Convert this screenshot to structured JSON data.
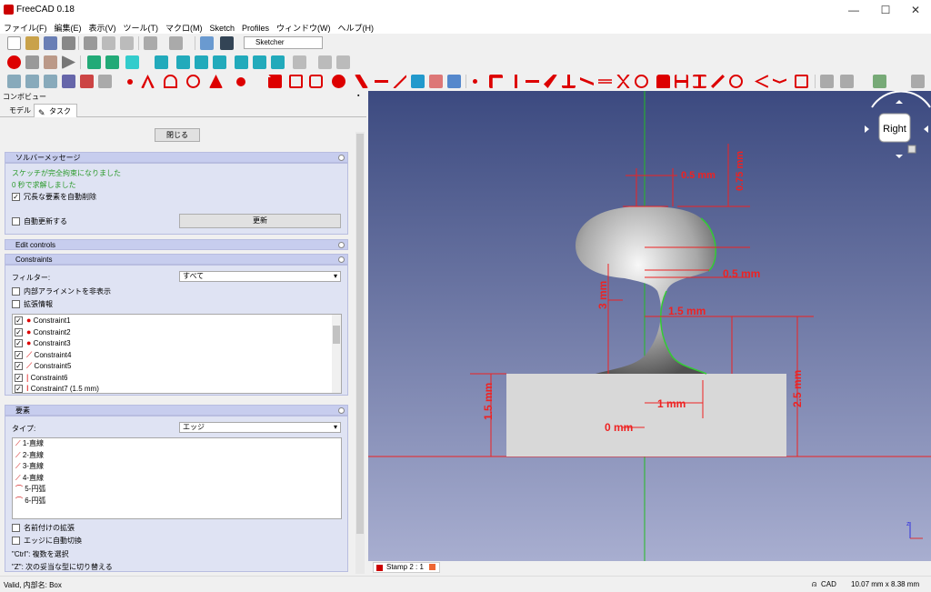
{
  "window": {
    "title": "FreeCAD 0.18"
  },
  "menu": [
    "ファイル(F)",
    "編集(E)",
    "表示(V)",
    "ツール(T)",
    "マクロ(M)",
    "Sketch",
    "Profiles",
    "ウィンドウ(W)",
    "ヘルプ(H)"
  ],
  "toolbar": {
    "workbench": "Sketcher"
  },
  "panel": {
    "title": "コンボビュー",
    "tabs": [
      "モデル",
      "タスク"
    ],
    "close_label": "閉じる"
  },
  "solver": {
    "title": "ソルバーメッセージ",
    "msg1": "スケッチが完全拘束になりました",
    "msg2": "0 秒で求解しました",
    "auto_remove": "冗長な要素を自動削除",
    "auto_update": "自動更新する",
    "update_btn": "更新"
  },
  "edit_controls": {
    "title": "Edit controls"
  },
  "constraints": {
    "title": "Constraints",
    "filter_label": "フィルター:",
    "filter_value": "すべて",
    "hide_internal": "内部アライメントを非表示",
    "extended": "拡張情報",
    "items": [
      "Constraint1",
      "Constraint2",
      "Constraint3",
      "Constraint4",
      "Constraint5",
      "Constraint6",
      "Constraint7 (1.5 mm)"
    ]
  },
  "elements": {
    "title": "要素",
    "type_label": "タイプ:",
    "type_value": "エッジ",
    "items": [
      "1-直線",
      "2-直線",
      "3-直線",
      "4-直線",
      "5-円弧",
      "6-円弧"
    ],
    "named_ext": "名前付けの拡張",
    "auto_edge": "エッジに自動切換",
    "hint1": "\"Ctrl\": 複数を選択",
    "hint2": "\"Z\": 次の妥当な型に切り替える"
  },
  "view": {
    "navcube": "Right",
    "tab": "Stamp 2 : 1",
    "dims": {
      "d1": "0.5 mm",
      "d2": "0.75 mm",
      "d3": "0.5 mm",
      "d4": "3 mm",
      "d5": "1.5 mm",
      "d6": "1.5 mm",
      "d7": "1 mm",
      "d8": "2.5 mm",
      "d9": "0 mm"
    }
  },
  "status": {
    "left": "Valid, 内部名: Box",
    "mode": "CAD",
    "size": "10.07 mm x 8.38 mm"
  }
}
